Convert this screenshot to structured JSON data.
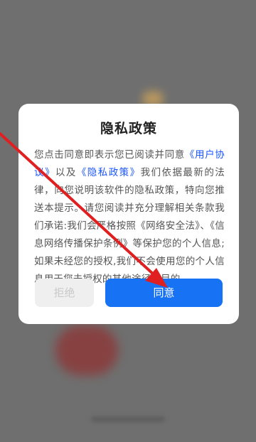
{
  "dialog": {
    "title": "隐私政策",
    "body": {
      "intro": "您点击同意即表示您已阅读并同意",
      "user_agreement_link": "《用户协议》",
      "and": "以及",
      "privacy_policy_link": "《隐私政策》",
      "rest": "我们依据最新的法律，向您说明该软件的隐私政策，特向您推送本提示。请您阅读并充分理解相关条款我们承诺:我们会严格按照《网络安全法》、《信息网络传播保护条例》等保护您的个人信息;如果未经您的授权,我们不会使用您的个人信息用于您未授权的其他途径或目的。"
    },
    "reject_label": "拒绝",
    "agree_label": "同意"
  },
  "colors": {
    "accent": "#1773f3",
    "link": "#1a55ff",
    "annotation_arrow": "#e02020",
    "backdrop": "#6f6f6f"
  }
}
